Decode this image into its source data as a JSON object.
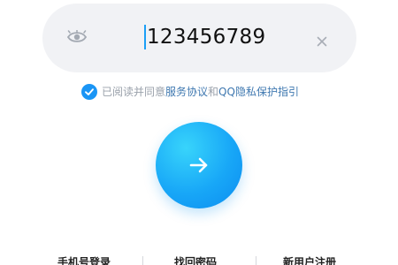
{
  "password_field": {
    "value": "123456789",
    "show_password_icon": "eye-icon",
    "clear_icon": "close-icon"
  },
  "agreement": {
    "checked": true,
    "prefix": "已阅读并同意",
    "service_agreement": "服务协议",
    "conjunction": "和",
    "privacy_guide": "QQ隐私保护指引"
  },
  "login_button": {
    "icon": "arrow-right-icon"
  },
  "bottom_links": {
    "phone_login": "手机号登录",
    "find_password": "找回密码",
    "new_user_register": "新用户注册"
  },
  "colors": {
    "accent": "#1a95f5",
    "link": "#3f78b0",
    "muted_text": "#9aa1ab",
    "field_background": "#f1f2f5"
  }
}
